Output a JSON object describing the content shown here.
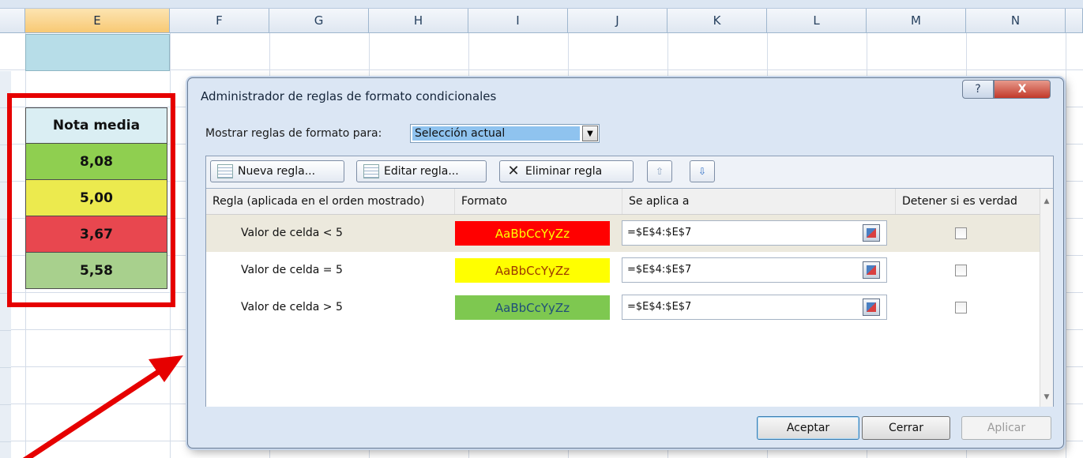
{
  "columns": [
    "E",
    "F",
    "G",
    "H",
    "I",
    "J",
    "K",
    "L",
    "M",
    "N"
  ],
  "selected_column": "E",
  "sheet": {
    "header": "Nota media",
    "values": [
      {
        "text": "8,08",
        "color": "#8fcf50"
      },
      {
        "text": "5,00",
        "color": "#ecea4e"
      },
      {
        "text": "3,67",
        "color": "#e8474f"
      },
      {
        "text": "5,58",
        "color": "#a8d08d"
      }
    ]
  },
  "dialog": {
    "title": "Administrador de reglas de formato condicionales",
    "help_label": "?",
    "close_label": "X",
    "show_rules_label": "Mostrar reglas de formato para:",
    "show_rules_value": "Selección actual",
    "toolbar": {
      "new_rule": "Nueva regla...",
      "edit_rule": "Editar regla...",
      "delete_rule": "Eliminar regla",
      "up_arrow": "⇧",
      "down_arrow": "⇩"
    },
    "grid_headers": {
      "rule": "Regla (aplicada en el orden mostrado)",
      "format": "Formato",
      "applies_to": "Se aplica a",
      "stop_if_true": "Detener si es verdad"
    },
    "rules": [
      {
        "rule": "Valor de celda < 5",
        "preview": "AaBbCcYyZz",
        "bg": "#ff0000",
        "fg": "#ffff00",
        "applies_to": "=$E$4:$E$7",
        "stop": false
      },
      {
        "rule": "Valor de celda = 5",
        "preview": "AaBbCcYyZz",
        "bg": "#ffff00",
        "fg": "#9c3800",
        "applies_to": "=$E$4:$E$7",
        "stop": false
      },
      {
        "rule": "Valor de celda > 5",
        "preview": "AaBbCcYyZz",
        "bg": "#7ec850",
        "fg": "#1f4e79",
        "applies_to": "=$E$4:$E$7",
        "stop": false
      }
    ],
    "buttons": {
      "ok": "Aceptar",
      "close": "Cerrar",
      "apply": "Aplicar"
    }
  },
  "annotation_color": "#e60000"
}
